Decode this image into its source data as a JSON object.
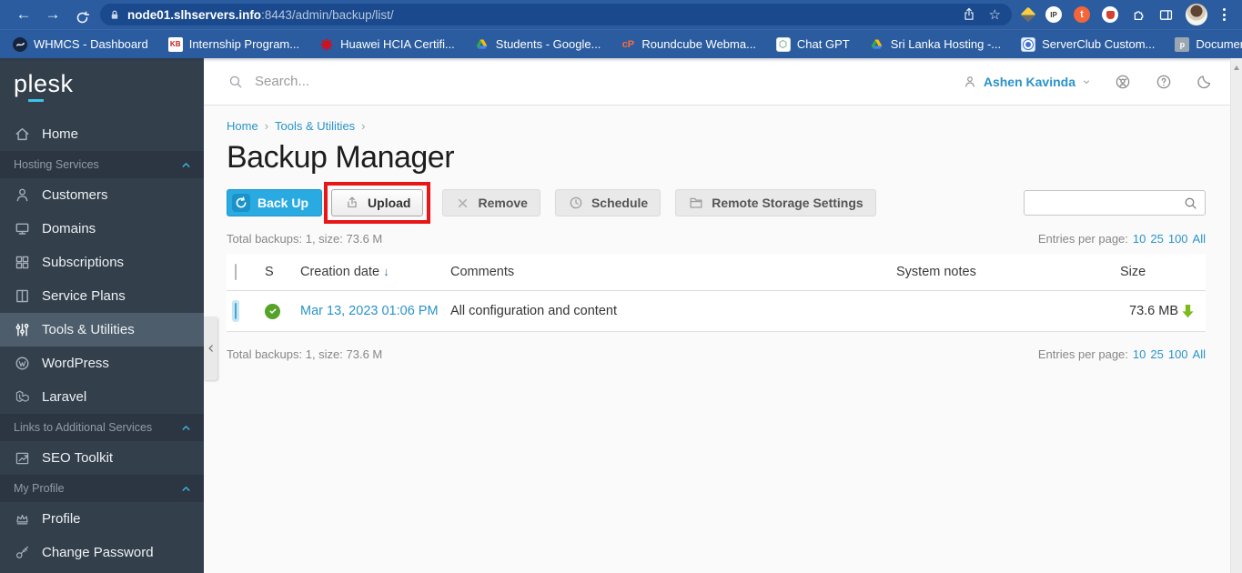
{
  "browser": {
    "url": {
      "host": "node01.slhservers.info",
      "rest": ":8443/admin/backup/list/"
    },
    "bookmarks": [
      {
        "label": "WHMCS - Dashboard"
      },
      {
        "label": "Internship Program..."
      },
      {
        "label": "Huawei HCIA Certifi..."
      },
      {
        "label": "Students - Google..."
      },
      {
        "label": "Roundcube Webma..."
      },
      {
        "label": "Chat GPT"
      },
      {
        "label": "Sri Lanka Hosting -..."
      },
      {
        "label": "ServerClub Custom..."
      },
      {
        "label": "Documentation an..."
      }
    ],
    "kb_glyph": "KB",
    "cp_glyph": "cP",
    "plesk_doc_glyph": "p",
    "ip_glyph": "IP",
    "t_glyph": "t",
    "overflow_chevron": "»",
    "back_glyph": "←",
    "forward_glyph": "→",
    "star_glyph": "☆"
  },
  "header": {
    "search_placeholder": "Search...",
    "user": "Ashen Kavinda"
  },
  "sidebar": {
    "logo": "plesk",
    "home": "Home",
    "sections": [
      {
        "header": "Hosting Services",
        "items": [
          {
            "label": "Customers"
          },
          {
            "label": "Domains"
          },
          {
            "label": "Subscriptions"
          },
          {
            "label": "Service Plans"
          },
          {
            "label": "Tools & Utilities"
          },
          {
            "label": "WordPress"
          },
          {
            "label": "Laravel"
          }
        ]
      },
      {
        "header": "Links to Additional Services",
        "items": [
          {
            "label": "SEO Toolkit"
          }
        ]
      },
      {
        "header": "My Profile",
        "items": [
          {
            "label": "Profile"
          },
          {
            "label": "Change Password"
          }
        ]
      }
    ]
  },
  "main": {
    "breadcrumb": [
      "Home",
      "Tools & Utilities"
    ],
    "breadcrumb_sep": "›",
    "title": "Backup Manager",
    "buttons": {
      "backup": "Back Up",
      "upload": "Upload",
      "remove": "Remove",
      "schedule": "Schedule",
      "remote": "Remote Storage Settings"
    },
    "totals": "Total backups: 1, size: 73.6 M",
    "entries": {
      "label": "Entries per page:",
      "options": [
        "10",
        "25",
        "100",
        "All"
      ]
    },
    "table": {
      "headers": {
        "status": "S",
        "date": "Creation date",
        "comments": "Comments",
        "notes": "System notes",
        "size": "Size"
      },
      "sort_indicator": "↓",
      "rows": [
        {
          "date": "Mar 13, 2023 01:06 PM",
          "comment": "All configuration and content",
          "size": "73.6 MB"
        }
      ]
    }
  },
  "colors": {
    "accent": "#28aade",
    "chrome_blue": "#2b5ca0",
    "annotation_red": "#e81717",
    "status_green": "#55a327",
    "download_green": "#7cba1d"
  }
}
